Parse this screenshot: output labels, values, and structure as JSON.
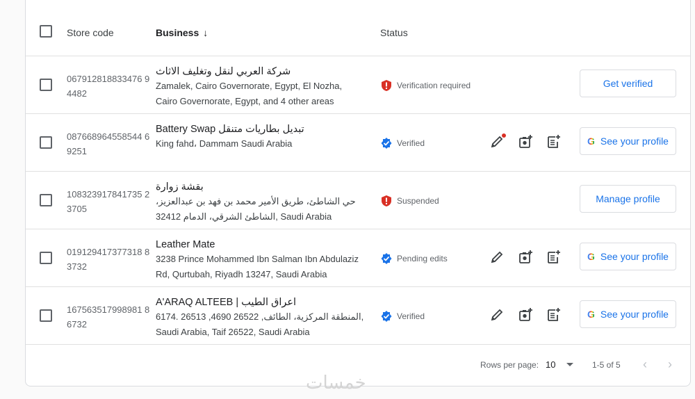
{
  "header": {
    "store_code": "Store code",
    "business": "Business",
    "sort_arrow": "↓",
    "status": "Status"
  },
  "rows": [
    {
      "code": "067912818833476 94482",
      "name": "شركة العربي لنقل وتغليف الاثاث",
      "address": "Zamalek, Cairo Governorate, Egypt, El Nozha, Cairo Governorate, Egypt, and 4 other areas",
      "status": "Verification required",
      "status_icon": "alert-shield-icon",
      "button": "Get verified",
      "has_actions": false
    },
    {
      "code": "087668964558544 69251",
      "name": "Battery Swap تبديل بطاريات متنقل",
      "address": "King fahd، Dammam Saudi Arabia",
      "status": "Verified",
      "status_icon": "verified-badge-icon",
      "button": "See your profile",
      "has_actions": true
    },
    {
      "code": "108323917841735 23705",
      "name": "بقشة زوارة",
      "address": "حي الشاطئ، طريق الأمير محمد بن فهد بن عبدالعزيز، الشاطئ الشرقي، الدمام 32412, Saudi Arabia",
      "status": "Suspended",
      "status_icon": "alert-shield-icon",
      "button": "Manage profile",
      "has_actions": false
    },
    {
      "code": "019129417377318 83732",
      "name": "Leather Mate",
      "address": "3238 Prince Mohammed Ibn Salman Ibn Abdulaziz Rd, Qurtubah, Riyadh 13247, Saudi Arabia",
      "status": "Pending edits",
      "status_icon": "verified-badge-icon",
      "button": "See your profile",
      "has_actions": true
    },
    {
      "code": "167563517998981 86732",
      "name": "A'ARAQ ALTEEB | اعراق الطيب",
      "address": "6174. 26513 ,4690 26522 ,المنطقة المركزية، الطائف, Saudi Arabia, Taif 26522, Saudi Arabia",
      "status": "Verified",
      "status_icon": "verified-badge-icon",
      "button": "See your profile",
      "has_actions": true
    }
  ],
  "footer": {
    "rows_per_page_label": "Rows per page:",
    "rows_per_page_value": "10",
    "range": "1-5 of 5",
    "prev": "‹",
    "next": "›"
  },
  "watermark": "خمسات",
  "google_letter": "G",
  "colors": {
    "accent": "#1a73e8",
    "alert": "#d93025",
    "verified": "#1a73e8"
  }
}
